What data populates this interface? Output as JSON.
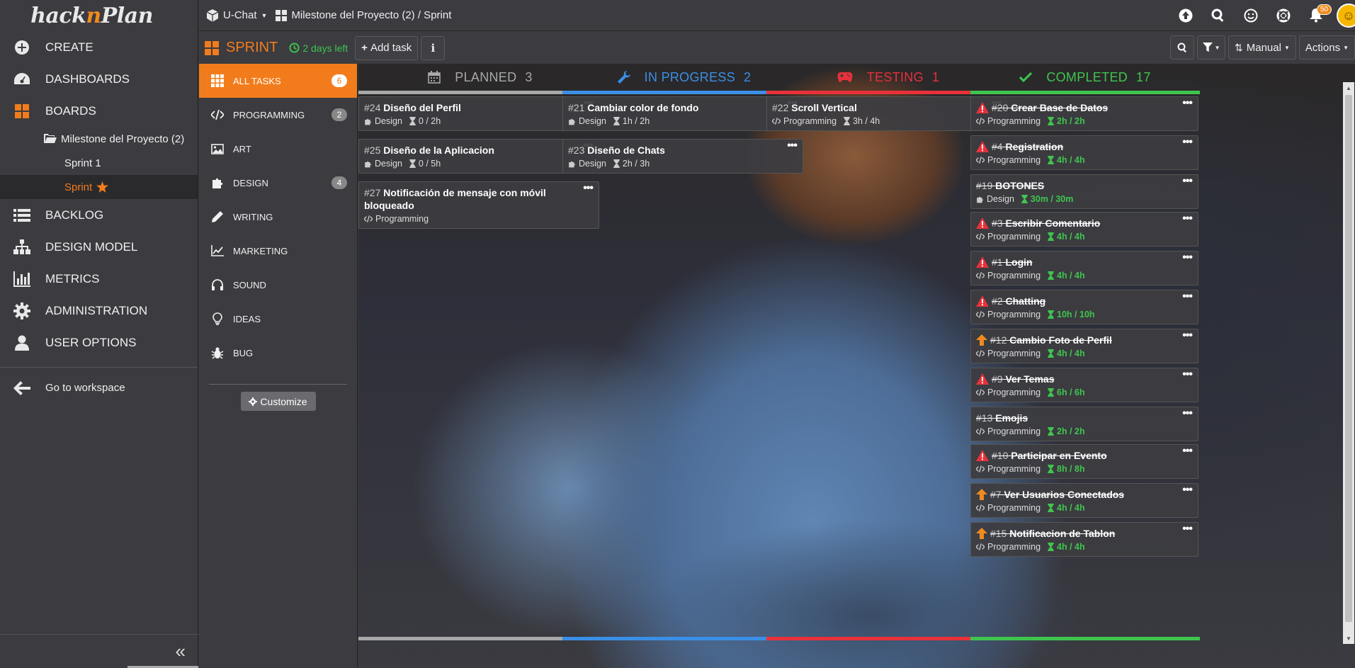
{
  "app": {
    "logo_a": "hack",
    "logo_n": "n",
    "logo_b": "Plan"
  },
  "nav": {
    "create": "CREATE",
    "dashboards": "DASHBOARDS",
    "boards": "BOARDS",
    "milestone": "Milestone del Proyecto (2)",
    "sprint1": "Sprint 1",
    "sprint": "Sprint",
    "backlog": "BACKLOG",
    "design_model": "DESIGN MODEL",
    "metrics": "METRICS",
    "administration": "ADMINISTRATION",
    "user_options": "USER OPTIONS",
    "go_workspace": "Go to workspace",
    "collapse": "«"
  },
  "topbar": {
    "project": "U-Chat",
    "breadcrumb": "Milestone del Proyecto (2) / Sprint",
    "notifications": "50"
  },
  "sprintbar": {
    "title": "SPRINT",
    "days_left": "2 days left",
    "add_task": "Add task",
    "info": "i",
    "sort": "Manual",
    "actions": "Actions"
  },
  "categories": [
    {
      "label": "ALL TASKS",
      "count": "6",
      "icon": "grid-icon"
    },
    {
      "label": "PROGRAMMING",
      "count": "2",
      "icon": "code-icon"
    },
    {
      "label": "ART",
      "count": "",
      "icon": "image-icon"
    },
    {
      "label": "DESIGN",
      "count": "4",
      "icon": "puzzle-icon"
    },
    {
      "label": "WRITING",
      "count": "",
      "icon": "pencil-icon"
    },
    {
      "label": "MARKETING",
      "count": "",
      "icon": "chart-icon"
    },
    {
      "label": "SOUND",
      "count": "",
      "icon": "headphones-icon"
    },
    {
      "label": "IDEAS",
      "count": "",
      "icon": "lightbulb-icon"
    },
    {
      "label": "BUG",
      "count": "",
      "icon": "bug-icon"
    }
  ],
  "customize": "Customize",
  "columns": [
    {
      "name": "PLANNED",
      "count": "3",
      "color": "#a8a8a8"
    },
    {
      "name": "IN PROGRESS",
      "count": "2",
      "color": "#3a8fe6"
    },
    {
      "name": "TESTING",
      "count": "1",
      "color": "#e8313a"
    },
    {
      "name": "COMPLETED",
      "count": "17",
      "color": "#3fc54e"
    }
  ],
  "planned": [
    {
      "num": "#24",
      "title": "Diseño del Perfil",
      "cat": "Design",
      "est": "0 / 2h"
    },
    {
      "num": "#25",
      "title": "Diseño de la Aplicacion",
      "cat": "Design",
      "est": "0 / 5h"
    },
    {
      "num": "#27",
      "title": "Notificación de mensaje con móvil bloqueado",
      "cat": "Programming",
      "est": ""
    }
  ],
  "in_progress": [
    {
      "num": "#21",
      "title": "Cambiar color de fondo",
      "cat": "Design",
      "est": "1h / 2h"
    },
    {
      "num": "#23",
      "title": "Diseño de Chats",
      "cat": "Design",
      "est": "2h / 3h"
    }
  ],
  "testing": [
    {
      "num": "#22",
      "title": "Scroll Vertical",
      "cat": "Programming",
      "est": "3h / 4h"
    }
  ],
  "completed": [
    {
      "num": "#20",
      "title": "Crear Base de Datos",
      "cat": "Programming",
      "est": "2h / 2h",
      "pri": "warn"
    },
    {
      "num": "#4",
      "title": "Registration",
      "cat": "Programming",
      "est": "4h / 4h",
      "pri": "warn"
    },
    {
      "num": "#19",
      "title": "BOTONES",
      "cat": "Design",
      "est": "30m / 30m",
      "pri": ""
    },
    {
      "num": "#3",
      "title": "Escribir Comentario",
      "cat": "Programming",
      "est": "4h / 4h",
      "pri": "warn"
    },
    {
      "num": "#1",
      "title": "Login",
      "cat": "Programming",
      "est": "4h / 4h",
      "pri": "warn"
    },
    {
      "num": "#2",
      "title": "Chatting",
      "cat": "Programming",
      "est": "10h / 10h",
      "pri": "warn"
    },
    {
      "num": "#12",
      "title": "Cambio Foto de Perfil",
      "cat": "Programming",
      "est": "4h / 4h",
      "pri": "up"
    },
    {
      "num": "#9",
      "title": "Ver Temas",
      "cat": "Programming",
      "est": "6h / 6h",
      "pri": "warn"
    },
    {
      "num": "#13",
      "title": "Emojis",
      "cat": "Programming",
      "est": "2h / 2h",
      "pri": ""
    },
    {
      "num": "#10",
      "title": "Participar en Evento",
      "cat": "Programming",
      "est": "8h / 8h",
      "pri": "warn"
    },
    {
      "num": "#7",
      "title": "Ver Usuarios Conectados",
      "cat": "Programming",
      "est": "4h / 4h",
      "pri": "up"
    },
    {
      "num": "#15",
      "title": "Notificacion de Tablon",
      "cat": "Programming",
      "est": "4h / 4h",
      "pri": "up"
    }
  ],
  "colors": {
    "accent": "#f27c1c",
    "success": "#3fc54e",
    "danger": "#e8313a",
    "info": "#3a8fe6"
  }
}
